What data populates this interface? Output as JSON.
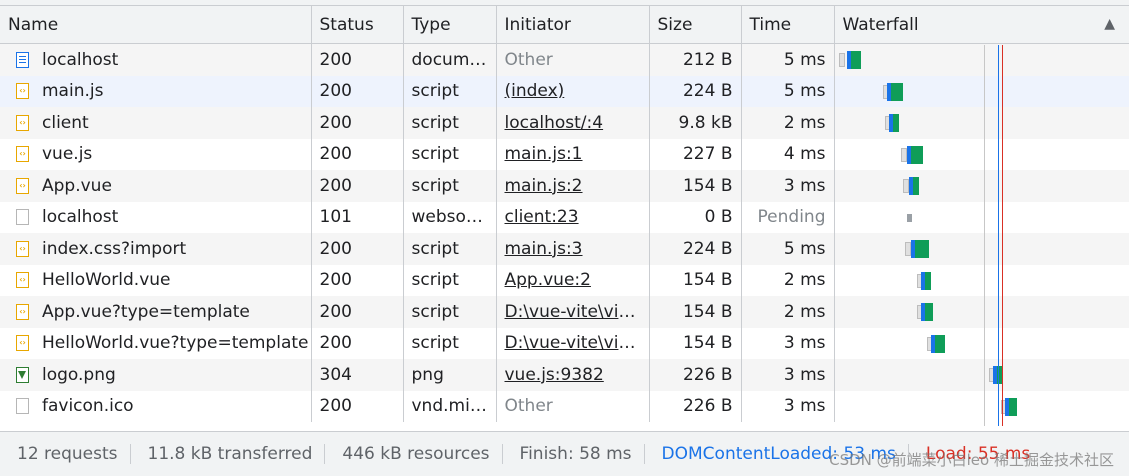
{
  "columns": {
    "name": "Name",
    "status": "Status",
    "type": "Type",
    "initiator": "Initiator",
    "size": "Size",
    "time": "Time",
    "waterfall": "Waterfall"
  },
  "sort_icon": "triangle-up-icon",
  "rows": [
    {
      "name": "localhost",
      "icon": "document-icon",
      "status": "200",
      "type": "docume…",
      "initiator": "Other",
      "initiator_link": false,
      "size": "212 B",
      "time": "5 ms"
    },
    {
      "name": "main.js",
      "icon": "script-icon",
      "status": "200",
      "type": "script",
      "initiator": "(index)",
      "initiator_link": true,
      "size": "224 B",
      "time": "5 ms"
    },
    {
      "name": "client",
      "icon": "script-icon",
      "status": "200",
      "type": "script",
      "initiator": "localhost/:4",
      "initiator_link": true,
      "size": "9.8 kB",
      "time": "2 ms"
    },
    {
      "name": "vue.js",
      "icon": "script-icon",
      "status": "200",
      "type": "script",
      "initiator": "main.js:1",
      "initiator_link": true,
      "size": "227 B",
      "time": "4 ms"
    },
    {
      "name": "App.vue",
      "icon": "script-icon",
      "status": "200",
      "type": "script",
      "initiator": "main.js:2",
      "initiator_link": true,
      "size": "154 B",
      "time": "3 ms"
    },
    {
      "name": "localhost",
      "icon": "blank-file-icon",
      "status": "101",
      "type": "websoc…",
      "initiator": "client:23",
      "initiator_link": true,
      "size": "0 B",
      "time": "Pending"
    },
    {
      "name": "index.css?import",
      "icon": "script-icon",
      "status": "200",
      "type": "script",
      "initiator": "main.js:3",
      "initiator_link": true,
      "size": "224 B",
      "time": "5 ms"
    },
    {
      "name": "HelloWorld.vue",
      "icon": "script-icon",
      "status": "200",
      "type": "script",
      "initiator": "App.vue:2",
      "initiator_link": true,
      "size": "154 B",
      "time": "2 ms"
    },
    {
      "name": "App.vue?type=template",
      "icon": "script-icon",
      "status": "200",
      "type": "script",
      "initiator": "D:\\vue-vite\\vite…",
      "initiator_link": true,
      "size": "154 B",
      "time": "2 ms"
    },
    {
      "name": "HelloWorld.vue?type=template",
      "icon": "script-icon",
      "status": "200",
      "type": "script",
      "initiator": "D:\\vue-vite\\vite…",
      "initiator_link": true,
      "size": "154 B",
      "time": "3 ms"
    },
    {
      "name": "logo.png",
      "icon": "image-icon",
      "status": "304",
      "type": "png",
      "initiator": "vue.js:9382",
      "initiator_link": true,
      "size": "226 B",
      "time": "3 ms"
    },
    {
      "name": "favicon.ico",
      "icon": "blank-file-icon",
      "status": "200",
      "type": "vnd.mic…",
      "initiator": "Other",
      "initiator_link": false,
      "size": "226 B",
      "time": "3 ms"
    }
  ],
  "footer": {
    "requests": "12 requests",
    "transferred": "11.8 kB transferred",
    "resources": "446 kB resources",
    "finish": "Finish: 58 ms",
    "dcl": "DOMContentLoaded: 53 ms",
    "load": "Load: 55 ms"
  },
  "watermark": "CSDN @前端菜小白leo 稀土掘金技术社区",
  "colors": {
    "dcl_line": "#1a73e8",
    "load_line": "#d93025",
    "selected_row": "#eef3fd"
  }
}
